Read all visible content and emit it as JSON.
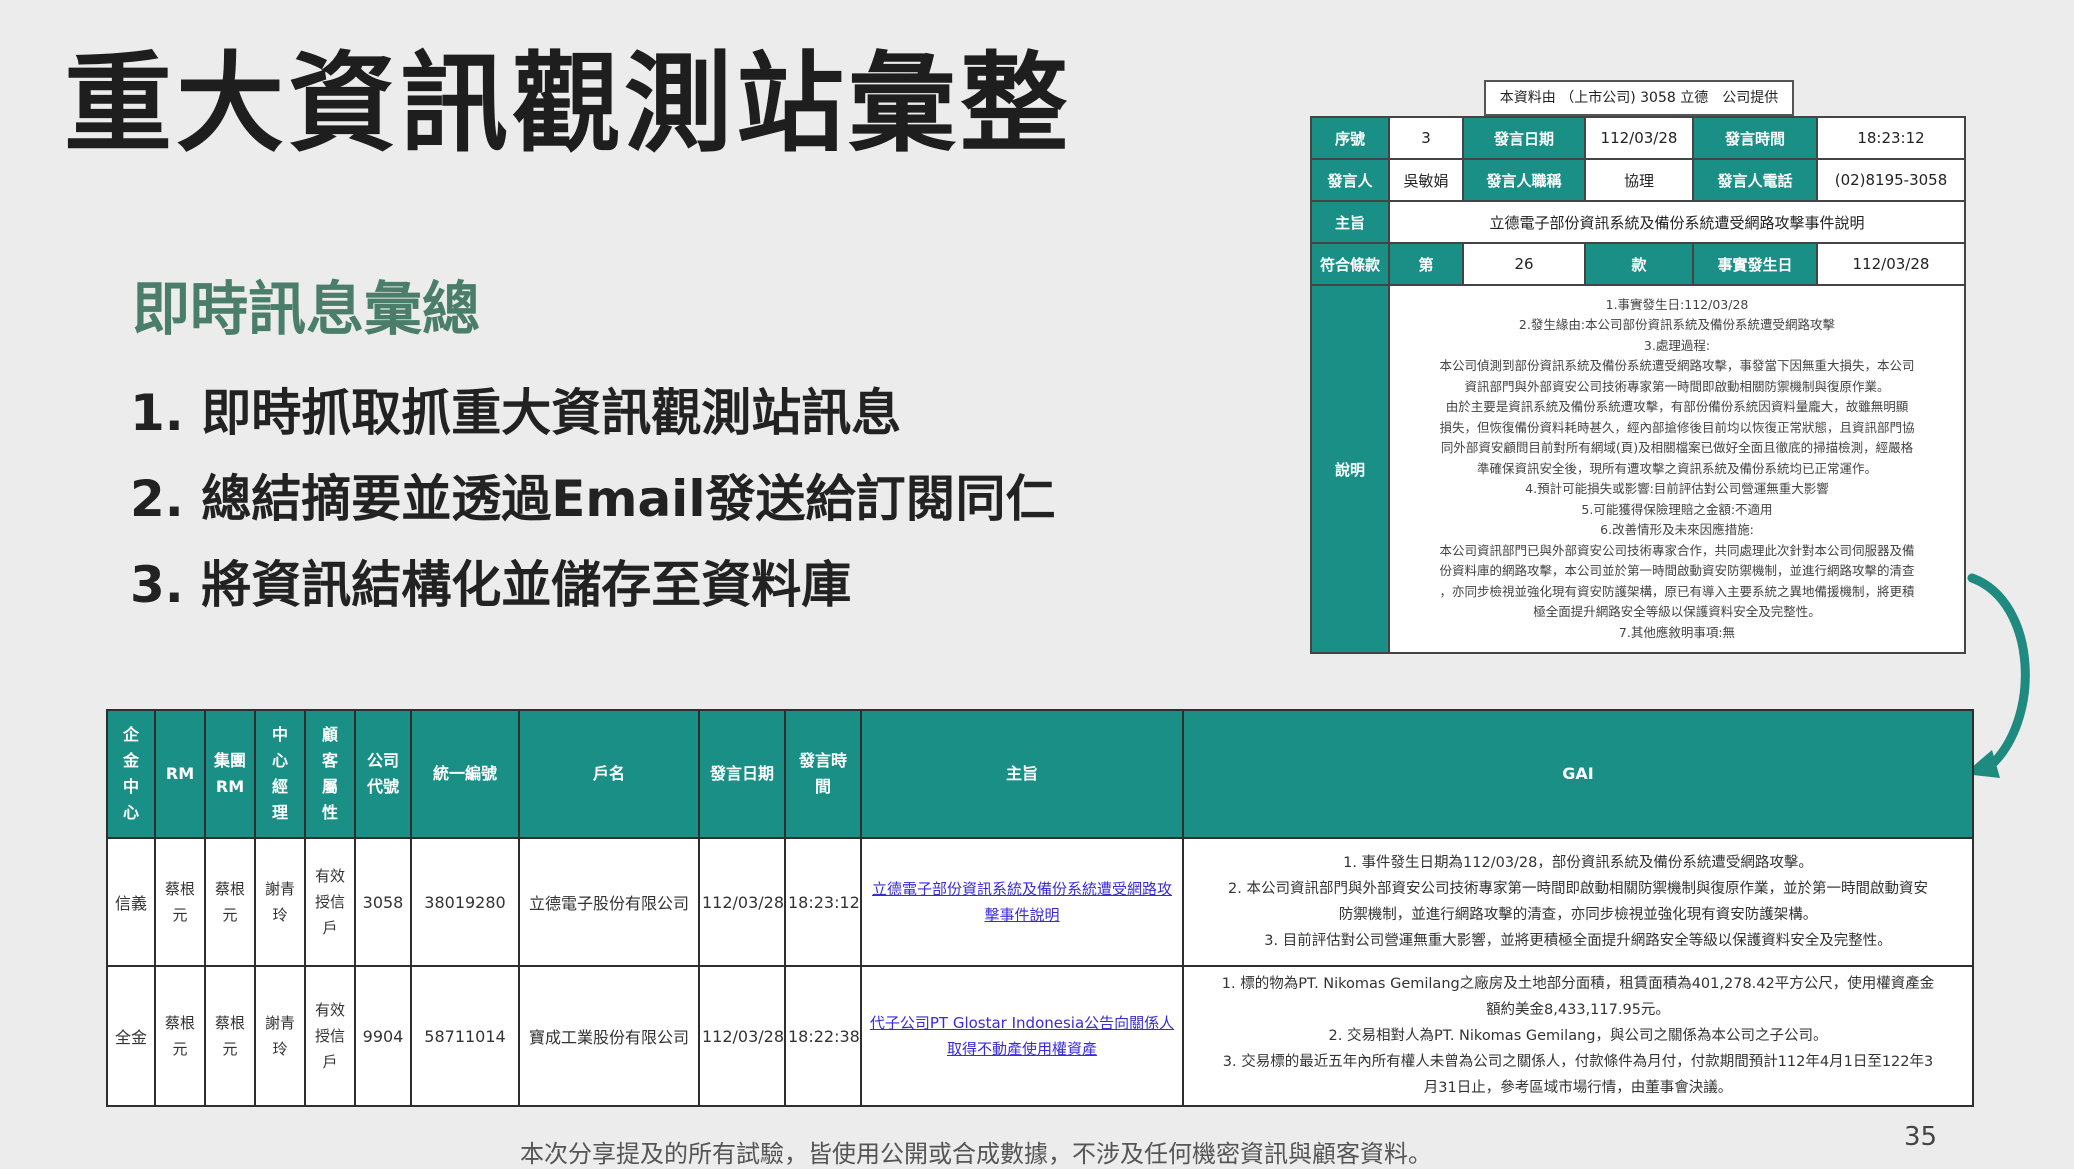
{
  "slide": {
    "title": "重大資訊觀測站彙整",
    "subtitle": "即時訊息彙總",
    "bullets": [
      "1. 即時抓取抓重大資訊觀測站訊息",
      "2. 總結摘要並透過Email發送給訂閱同仁",
      "3. 將資訊結構化並儲存至資料庫"
    ],
    "footer": "本次分享提及的所有試驗，皆使用公開或合成數據，不涉及任何機密資訊與顧客資料。",
    "page_number": "35"
  },
  "detail": {
    "source": "本資料由 （上市公司) 3058 立德　公司提供",
    "row1": [
      "序號",
      "3",
      "發言日期",
      "112/03/28",
      "發言時間",
      "18:23:12"
    ],
    "row2": [
      "發言人",
      "吳敏娟",
      "發言人職稱",
      "協理",
      "發言人電話",
      "(02)8195-3058"
    ],
    "subject_label": "主旨",
    "subject": "立德電子部份資訊系統及備份系統遭受網路攻擊事件說明",
    "row4": [
      "符合條款",
      "第",
      "26",
      "款",
      "事實發生日",
      "112/03/28"
    ],
    "desc_label": "說明",
    "desc_lines": [
      "1.事實發生日:112/03/28",
      "2.發生緣由:本公司部份資訊系統及備份系統遭受網路攻擊",
      "3.處理過程:",
      "本公司偵測到部份資訊系統及備份系統遭受網路攻擊，事發當下因無重大損失，本公司",
      "資訊部門與外部資安公司技術專家第一時間即啟動相關防禦機制與復原作業。",
      "由於主要是資訊系統及備份系統遭攻擊，有部份備份系統因資料量龐大，故雖無明顯",
      "損失，但恢復備份資料耗時甚久，經內部搶修後目前均以恢復正常狀態，且資訊部門協",
      "同外部資安顧問目前對所有網域(頁)及相關檔案已做好全面且徹底的掃描檢測，經嚴格",
      "準確保資訊安全後，現所有遭攻擊之資訊系統及備份系統均已正常運作。",
      "4.預計可能損失或影響:目前評估對公司營運無重大影響",
      "5.可能獲得保險理賠之金額:不適用",
      "6.改善情形及未來因應措施:",
      "本公司資訊部門已與外部資安公司技術專家合作，共同處理此次針對本公司伺服器及備",
      "份資料庫的網路攻擊，本公司並於第一時間啟動資安防禦機制，並進行網路攻擊的清查",
      "，亦同步檢視並強化現有資安防護架構，原已有導入主要系統之異地備援機制，將更積",
      "極全面提升網路安全等級以保護資料安全及完整性。",
      "7.其他應敘明事項:無"
    ]
  },
  "table": {
    "headers": [
      "企金中心",
      "RM",
      "集團RM",
      "中心經理",
      "顧客屬性",
      "公司代號",
      "統一編號",
      "戶名",
      "發言日期",
      "發言時間",
      "主旨",
      "GAI"
    ],
    "rows": [
      {
        "center": "信義",
        "rm": "蔡根元",
        "group_rm": "蔡根元",
        "manager": "謝青玲",
        "attr": "有效授信戶",
        "code": "3058",
        "tax_id": "38019280",
        "name": "立德電子股份有限公司",
        "date": "112/03/28",
        "time": "18:23:12",
        "subject": "立德電子部份資訊系統及備份系統遭受網路攻擊事件說明",
        "gai": [
          "1. 事件發生日期為112/03/28，部份資訊系統及備份系統遭受網路攻擊。",
          "2. 本公司資訊部門與外部資安公司技術專家第一時間即啟動相關防禦機制與復原作業，並於第一時間啟動資安",
          "防禦機制，並進行網路攻擊的清查，亦同步檢視並強化現有資安防護架構。",
          "3. 目前評估對公司營運無重大影響，並將更積極全面提升網路安全等級以保護資料安全及完整性。"
        ]
      },
      {
        "center": "全金",
        "rm": "蔡根元",
        "group_rm": "蔡根元",
        "manager": "謝青玲",
        "attr": "有效授信戶",
        "code": "9904",
        "tax_id": "58711014",
        "name": "寶成工業股份有限公司",
        "date": "112/03/28",
        "time": "18:22:38",
        "subject": "代子公司PT Glostar Indonesia公告向關係人取得不動產使用權資產",
        "gai": [
          "1. 標的物為PT. Nikomas Gemilang之廠房及土地部分面積，租賃面積為401,278.42平方公尺，使用權資產金",
          "額約美金8,433,117.95元。",
          "2. 交易相對人為PT. Nikomas Gemilang，與公司之關係為本公司之子公司。",
          "3. 交易標的最近五年內所有權人未曾為公司之關係人，付款條件為月付，付款期間預計112年4月1日至122年3",
          "月31日止，參考區域市場行情，由董事會決議。"
        ]
      }
    ]
  },
  "colors": {
    "header_teal": "#1a8f86",
    "subtitle_green": "#4a7d6a",
    "link_blue": "#3a2bd6",
    "arrow_teal": "#1e8a80"
  }
}
